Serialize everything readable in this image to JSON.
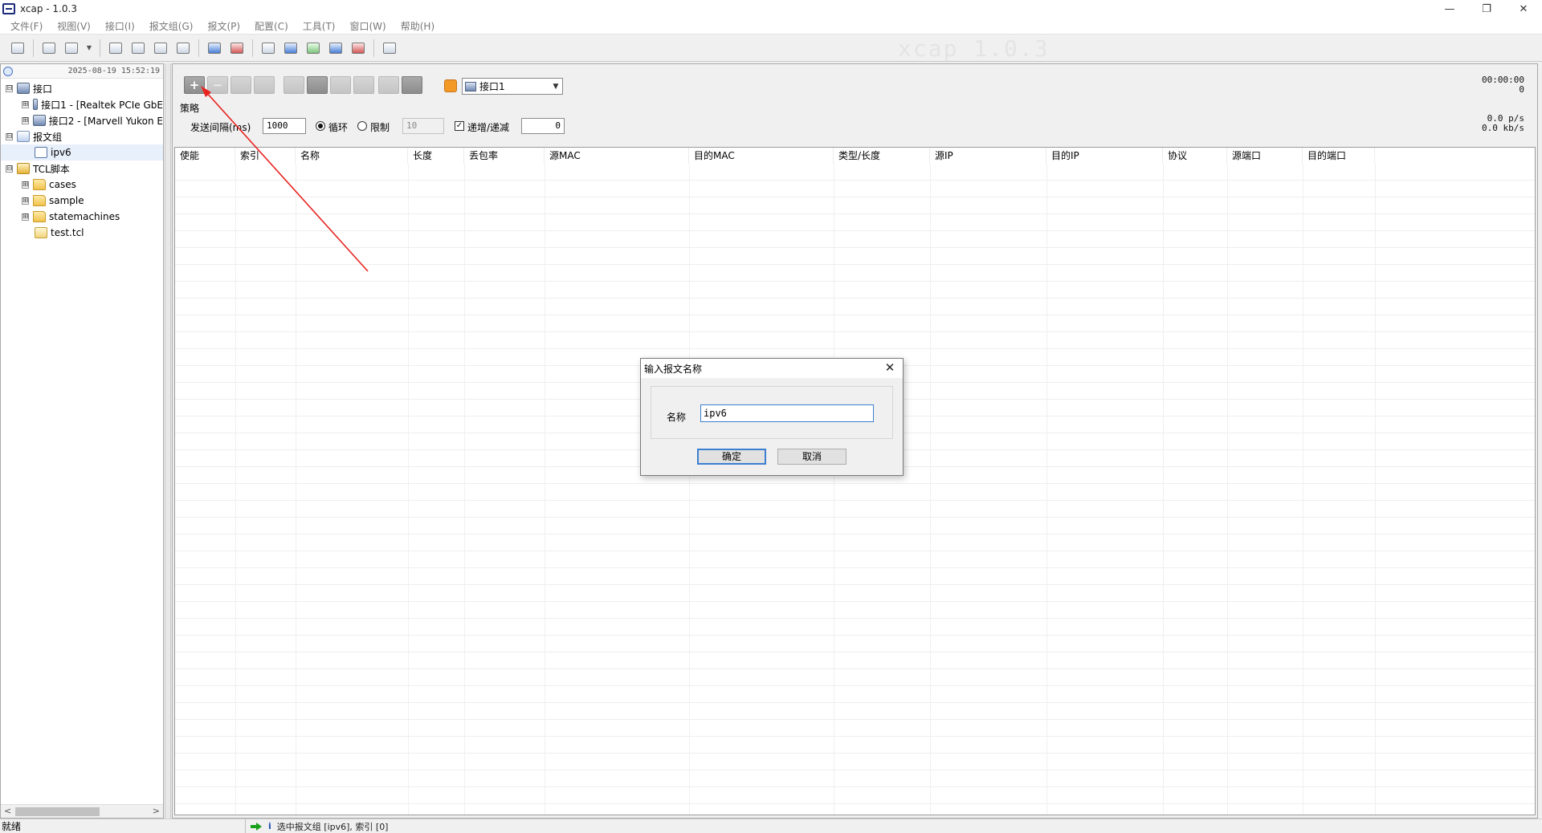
{
  "window": {
    "title": "xcap - 1.0.3",
    "minimize": "—",
    "restore": "❐",
    "close": "✕"
  },
  "menu": [
    "文件(F)",
    "视图(V)",
    "接口(I)",
    "报文组(G)",
    "报文(P)",
    "配置(C)",
    "工具(T)",
    "窗口(W)",
    "帮助(H)"
  ],
  "toolbar": {
    "watermark": "xcap 1.0.3",
    "icons": [
      "open-icon",
      "start-capture-icon",
      "stop-capture-icon",
      "dropdown-icon",
      "send-icon",
      "stop-send-icon",
      "save-icon",
      "book-icon",
      "add-group-icon",
      "remove-group-icon",
      "export-icon",
      "chart-icon",
      "report-icon",
      "stats-icon",
      "gem-icon",
      "chat-icon"
    ]
  },
  "tree": {
    "datetime": "2025-08-19 15:52:19",
    "nodes": [
      {
        "label": "接口",
        "expander": "⊟",
        "icon": "network-icon"
      },
      {
        "label": "接口1 - [Realtek PCIe GbE",
        "expander": "⊞",
        "icon": "nic-icon"
      },
      {
        "label": "接口2 - [Marvell Yukon E",
        "expander": "⊞",
        "icon": "nic-icon"
      },
      {
        "label": "报文组",
        "expander": "⊟",
        "icon": "packet-group-icon"
      },
      {
        "label": "ipv6",
        "expander": "",
        "icon": "packet-icon"
      },
      {
        "label": "TCL脚本",
        "expander": "⊟",
        "icon": "script-icon"
      },
      {
        "label": "cases",
        "expander": "⊞",
        "icon": "folder-icon"
      },
      {
        "label": "sample",
        "expander": "⊞",
        "icon": "folder-icon"
      },
      {
        "label": "statemachines",
        "expander": "⊞",
        "icon": "folder-icon"
      },
      {
        "label": "test.tcl",
        "expander": "",
        "icon": "file-icon"
      }
    ]
  },
  "strategy": {
    "plus": "+",
    "minus": "−",
    "interface": "接口1",
    "timer": "00:00:00",
    "counter": "0",
    "rate_pps": "0.0  p/s",
    "rate_kbps": "0.0 kb/s",
    "title": "策略",
    "interval_label": "发送间隔(ms)",
    "interval_value": "1000",
    "loop_label": "循环",
    "limit_label": "限制",
    "limit_value": "10",
    "incdec_label": "递增/递减",
    "incdec_value": "0",
    "checkmark": "✓"
  },
  "table": {
    "columns": [
      "使能",
      "索引",
      "名称",
      "长度",
      "丢包率",
      "源MAC",
      "目的MAC",
      "类型/长度",
      "源IP",
      "目的IP",
      "协议",
      "源端口",
      "目的端口"
    ],
    "rows": []
  },
  "dialog": {
    "title": "输入报文名称",
    "close": "✕",
    "name_label": "名称",
    "name_value": "ipv6",
    "ok": "确定",
    "cancel": "取消"
  },
  "status": {
    "ready": "就绪",
    "message": "选中报文组 [ipv6], 索引 [0]",
    "info": "i"
  },
  "colors": {
    "annotation_arrow": "#e8231f",
    "focus": "#3c7fd1"
  }
}
